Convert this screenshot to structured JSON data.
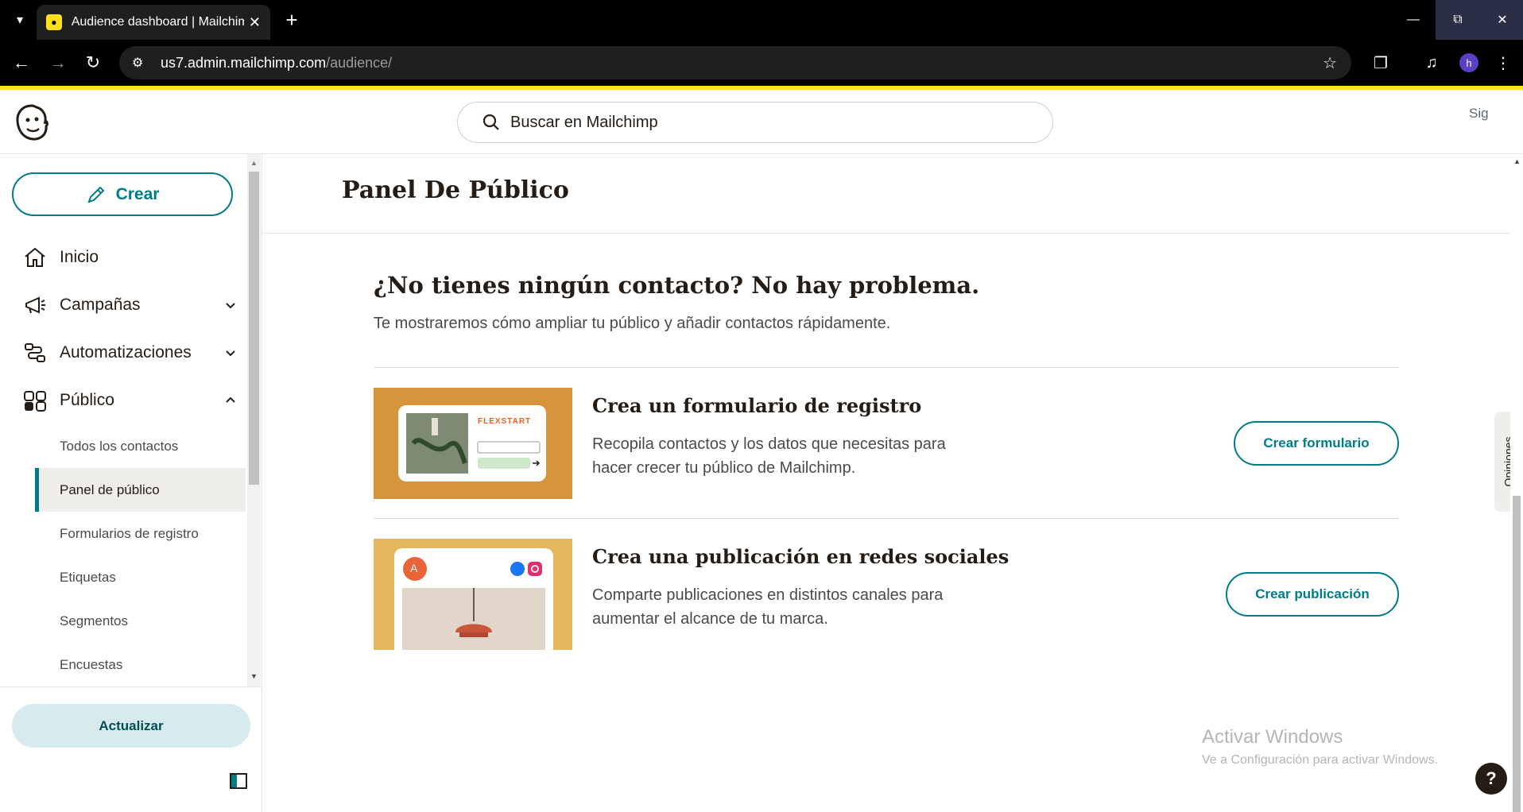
{
  "browser": {
    "tab_title": "Audience dashboard | Mailchimp",
    "tab_favicon": "mailchimp-favicon",
    "url_host": "us7.admin.mailchimp.com",
    "url_path": "/audience/",
    "profile_initial": "h"
  },
  "header": {
    "search_placeholder": "Buscar en Mailchimp",
    "signin_alt": "Sig"
  },
  "sidebar": {
    "create_label": "Crear",
    "items": [
      {
        "label": "Inicio",
        "icon": "home-icon"
      },
      {
        "label": "Campañas",
        "icon": "megaphone-icon"
      },
      {
        "label": "Automatizaciones",
        "icon": "automation-icon"
      },
      {
        "label": "Público",
        "icon": "audience-icon"
      }
    ],
    "sub_items": [
      {
        "label": "Todos los contactos"
      },
      {
        "label": "Panel de público"
      },
      {
        "label": "Formularios de registro"
      },
      {
        "label": "Etiquetas"
      },
      {
        "label": "Segmentos"
      },
      {
        "label": "Encuestas"
      }
    ],
    "upgrade_label": "Actualizar"
  },
  "main": {
    "page_title": "Panel De Público",
    "empty_title": "¿No tienes ningún contacto? No hay problema.",
    "empty_subtitle": "Te mostraremos cómo ampliar tu público y añadir contactos rápidamente.",
    "cards": [
      {
        "title": "Crea un formulario de registro",
        "description": "Recopila contactos y los datos que necesitas para hacer crecer tu público de Mailchimp.",
        "button": "Crear formulario",
        "image_brand": "FLEXSTART",
        "image_bg": "#d6953a"
      },
      {
        "title": "Crea una publicación en redes sociales",
        "description": "Comparte publicaciones en distintos canales para aumentar el alcance de tu marca.",
        "button": "Crear publicación",
        "image_avatar": "A",
        "image_bg": "#e6b85d"
      }
    ]
  },
  "feedback_label": "Opiniones",
  "watermark": {
    "title": "Activar Windows",
    "subtitle": "Ve a Configuración para activar Windows."
  },
  "help_label": "?",
  "colors": {
    "accent": "#007c89",
    "brand_yellow": "#ffe01b",
    "text": "#241c15"
  }
}
